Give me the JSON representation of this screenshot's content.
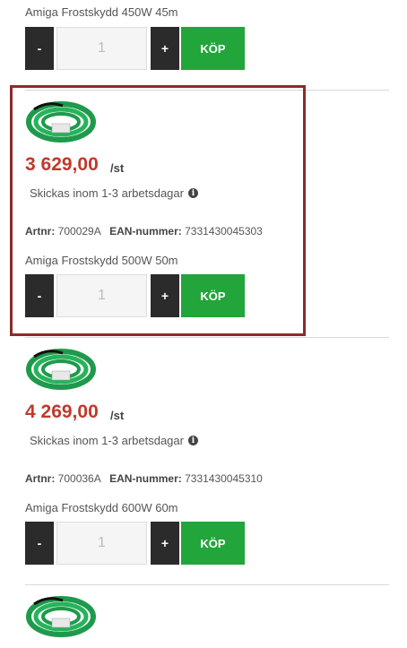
{
  "products": [
    {
      "title": "Amiga Frostskydd 450W 45m",
      "quantity": "1",
      "minus_label": "-",
      "plus_label": "+",
      "buy_label": "KÖP"
    },
    {
      "price": "3 629,00",
      "unit": "/st",
      "shipping": "Skickas inom 1-3 arbetsdagar",
      "artnr_label": "Artnr:",
      "artnr": "700029A",
      "ean_label": "EAN-nummer:",
      "ean": "7331430045303",
      "title": "Amiga Frostskydd 500W 50m",
      "quantity": "1",
      "minus_label": "-",
      "plus_label": "+",
      "buy_label": "KÖP"
    },
    {
      "price": "4 269,00",
      "unit": "/st",
      "shipping": "Skickas inom 1-3 arbetsdagar",
      "artnr_label": "Artnr:",
      "artnr": "700036A",
      "ean_label": "EAN-nummer:",
      "ean": "7331430045310",
      "title": "Amiga Frostskydd 600W 60m",
      "quantity": "1",
      "minus_label": "-",
      "plus_label": "+",
      "buy_label": "KÖP"
    }
  ],
  "info_icon_glyph": "i",
  "colors": {
    "price": "#c0392b",
    "buy_button": "#22a53a",
    "qty_buttons": "#2b2b2b",
    "highlight_border": "#8c2b2b"
  }
}
